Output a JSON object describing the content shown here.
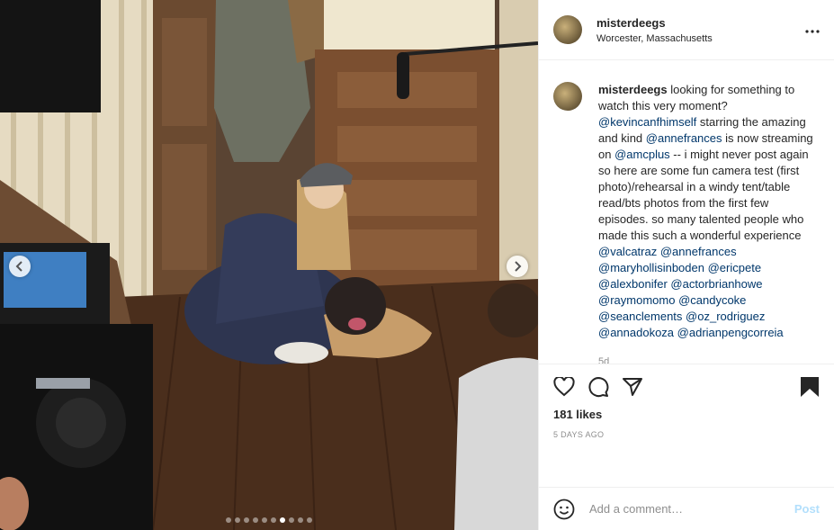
{
  "post": {
    "username": "misterdeegs",
    "location": "Worcester, Massachusetts",
    "more_icon": "more-horizontal-icon"
  },
  "caption": {
    "username": "misterdeegs",
    "segments": [
      {
        "t": "text",
        "v": " looking for something to watch this very moment? "
      },
      {
        "t": "mention",
        "v": "@kevincanfhimself"
      },
      {
        "t": "text",
        "v": " starring the amazing and kind "
      },
      {
        "t": "mention",
        "v": "@annefrances"
      },
      {
        "t": "text",
        "v": " is now streaming on "
      },
      {
        "t": "mention",
        "v": "@amcplus"
      },
      {
        "t": "text",
        "v": " -- i might never post again so here are some fun camera test (first photo)/rehearsal in a windy tent/table read/bts photos from the first few episodes. so many talented people who made this such a wonderful experience "
      },
      {
        "t": "mention",
        "v": "@valcatraz"
      },
      {
        "t": "text",
        "v": " "
      },
      {
        "t": "mention",
        "v": "@annefrances"
      },
      {
        "t": "text",
        "v": " "
      },
      {
        "t": "mention",
        "v": "@maryhollisinboden"
      },
      {
        "t": "text",
        "v": " "
      },
      {
        "t": "mention",
        "v": "@ericpete"
      },
      {
        "t": "text",
        "v": " "
      },
      {
        "t": "mention",
        "v": "@alexbonifer"
      },
      {
        "t": "text",
        "v": " "
      },
      {
        "t": "mention",
        "v": "@actorbrianhowe"
      },
      {
        "t": "text",
        "v": " "
      },
      {
        "t": "mention",
        "v": "@raymomomo"
      },
      {
        "t": "text",
        "v": " "
      },
      {
        "t": "mention",
        "v": "@candycoke"
      },
      {
        "t": "text",
        "v": " "
      },
      {
        "t": "mention",
        "v": "@seanclements"
      },
      {
        "t": "text",
        "v": " "
      },
      {
        "t": "mention",
        "v": "@oz_rodriguez"
      },
      {
        "t": "text",
        "v": " "
      },
      {
        "t": "mention",
        "v": "@annadokoza"
      },
      {
        "t": "text",
        "v": " "
      },
      {
        "t": "mention",
        "v": "@adrianpengcorreia"
      }
    ],
    "age": "5d"
  },
  "engagement": {
    "likes": "181 likes",
    "posted": "5 DAYS AGO"
  },
  "carousel": {
    "total": 10,
    "active_index": 6
  },
  "comment_box": {
    "placeholder": "Add a comment…",
    "post_label": "Post"
  },
  "colors": {
    "mention": "#00376b",
    "post_disabled": "#b2dffc",
    "muted": "#8e8e8e"
  }
}
